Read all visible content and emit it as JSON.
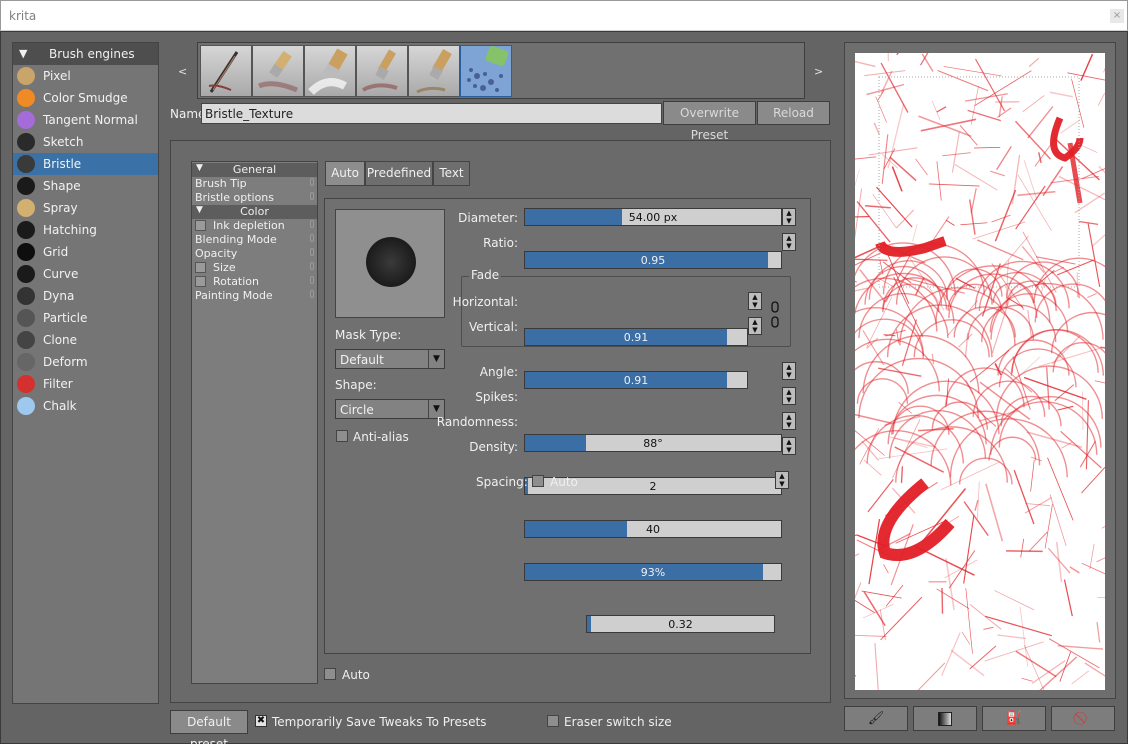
{
  "window": {
    "title": "krita",
    "close_glyph": "×"
  },
  "engines": {
    "header": "Brush engines",
    "items": [
      {
        "label": "Pixel",
        "icon": "pixel-brush-icon",
        "color": "#c9a56a"
      },
      {
        "label": "Color Smudge",
        "icon": "color-smudge-icon",
        "color": "#f08a24"
      },
      {
        "label": "Tangent Normal",
        "icon": "tangent-normal-icon",
        "color": "#a46cd8"
      },
      {
        "label": "Sketch",
        "icon": "sketch-icon",
        "color": "#2a2a2a"
      },
      {
        "label": "Bristle",
        "icon": "bristle-icon",
        "color": "#3a3a3a",
        "selected": true
      },
      {
        "label": "Shape",
        "icon": "shape-icon",
        "color": "#1a1a1a"
      },
      {
        "label": "Spray",
        "icon": "spray-icon",
        "color": "#d2b070"
      },
      {
        "label": "Hatching",
        "icon": "hatching-icon",
        "color": "#1a1a1a"
      },
      {
        "label": "Grid",
        "icon": "grid-icon",
        "color": "#0e0e0e"
      },
      {
        "label": "Curve",
        "icon": "curve-icon",
        "color": "#1a1a1a"
      },
      {
        "label": "Dyna",
        "icon": "dyna-icon",
        "color": "#333333"
      },
      {
        "label": "Particle",
        "icon": "particle-icon",
        "color": "#555555"
      },
      {
        "label": "Clone",
        "icon": "clone-icon",
        "color": "#444444"
      },
      {
        "label": "Deform",
        "icon": "deform-icon",
        "color": "#666666"
      },
      {
        "label": "Filter",
        "icon": "filter-icon",
        "color": "#d43030"
      },
      {
        "label": "Chalk",
        "icon": "chalk-icon",
        "color": "#9fc8ee"
      }
    ]
  },
  "presets": {
    "prev": "<",
    "next": ">",
    "name_label": "Name:",
    "name_value": "Bristle_Texture",
    "overwrite": "Overwrite Preset",
    "reload": "Reload"
  },
  "options": {
    "items": [
      {
        "label": "General",
        "type": "header"
      },
      {
        "label": "Brush Tip",
        "type": "item"
      },
      {
        "label": "Bristle options",
        "type": "item"
      },
      {
        "label": "Color",
        "type": "header"
      },
      {
        "label": "Ink depletion",
        "type": "check"
      },
      {
        "label": "Blending Mode",
        "type": "item"
      },
      {
        "label": "Opacity",
        "type": "item"
      },
      {
        "label": "Size",
        "type": "check"
      },
      {
        "label": "Rotation",
        "type": "check"
      },
      {
        "label": "Painting Mode",
        "type": "item"
      }
    ],
    "auto_label": "Auto"
  },
  "tip": {
    "tabs": [
      "Auto",
      "Predefined",
      "Text"
    ],
    "mask_type_label": "Mask Type:",
    "mask_type_value": "Default",
    "shape_label": "Shape:",
    "shape_value": "Circle",
    "antialias_label": "Anti-alias",
    "fade_label": "Fade",
    "spacing_label": "Spacing:",
    "spacing_auto_label": "Auto",
    "sliders": {
      "diameter": {
        "label": "Diameter:",
        "value": "54.00 px",
        "fraction": 0.38
      },
      "ratio": {
        "label": "Ratio:",
        "value": "0.95",
        "fraction": 0.95
      },
      "horizontal": {
        "label": "Horizontal:",
        "value": "0.91",
        "fraction": 0.91
      },
      "vertical": {
        "label": "Vertical:",
        "value": "0.91",
        "fraction": 0.91
      },
      "angle": {
        "label": "Angle:",
        "value": "88°",
        "fraction": 0.24
      },
      "spikes": {
        "label": "Spikes:",
        "value": "2",
        "fraction": 0.01
      },
      "randomness": {
        "label": "Randomness:",
        "value": "40",
        "fraction": 0.4
      },
      "density": {
        "label": "Density:",
        "value": "93%",
        "fraction": 0.93
      },
      "spacing": {
        "label": "",
        "value": "0.32",
        "fraction": 0.02
      }
    }
  },
  "bottom": {
    "default_preset": "Default preset",
    "temp_save_label": "Temporarily Save Tweaks To Presets",
    "temp_save_checked": true,
    "eraser_label": "Eraser switch size"
  },
  "scratchpad": {
    "stroke_color": "#e21f26",
    "buttons": [
      "brush-fill-icon",
      "gradient-fill-icon",
      "paint-bucket-icon",
      "clear-icon"
    ]
  }
}
